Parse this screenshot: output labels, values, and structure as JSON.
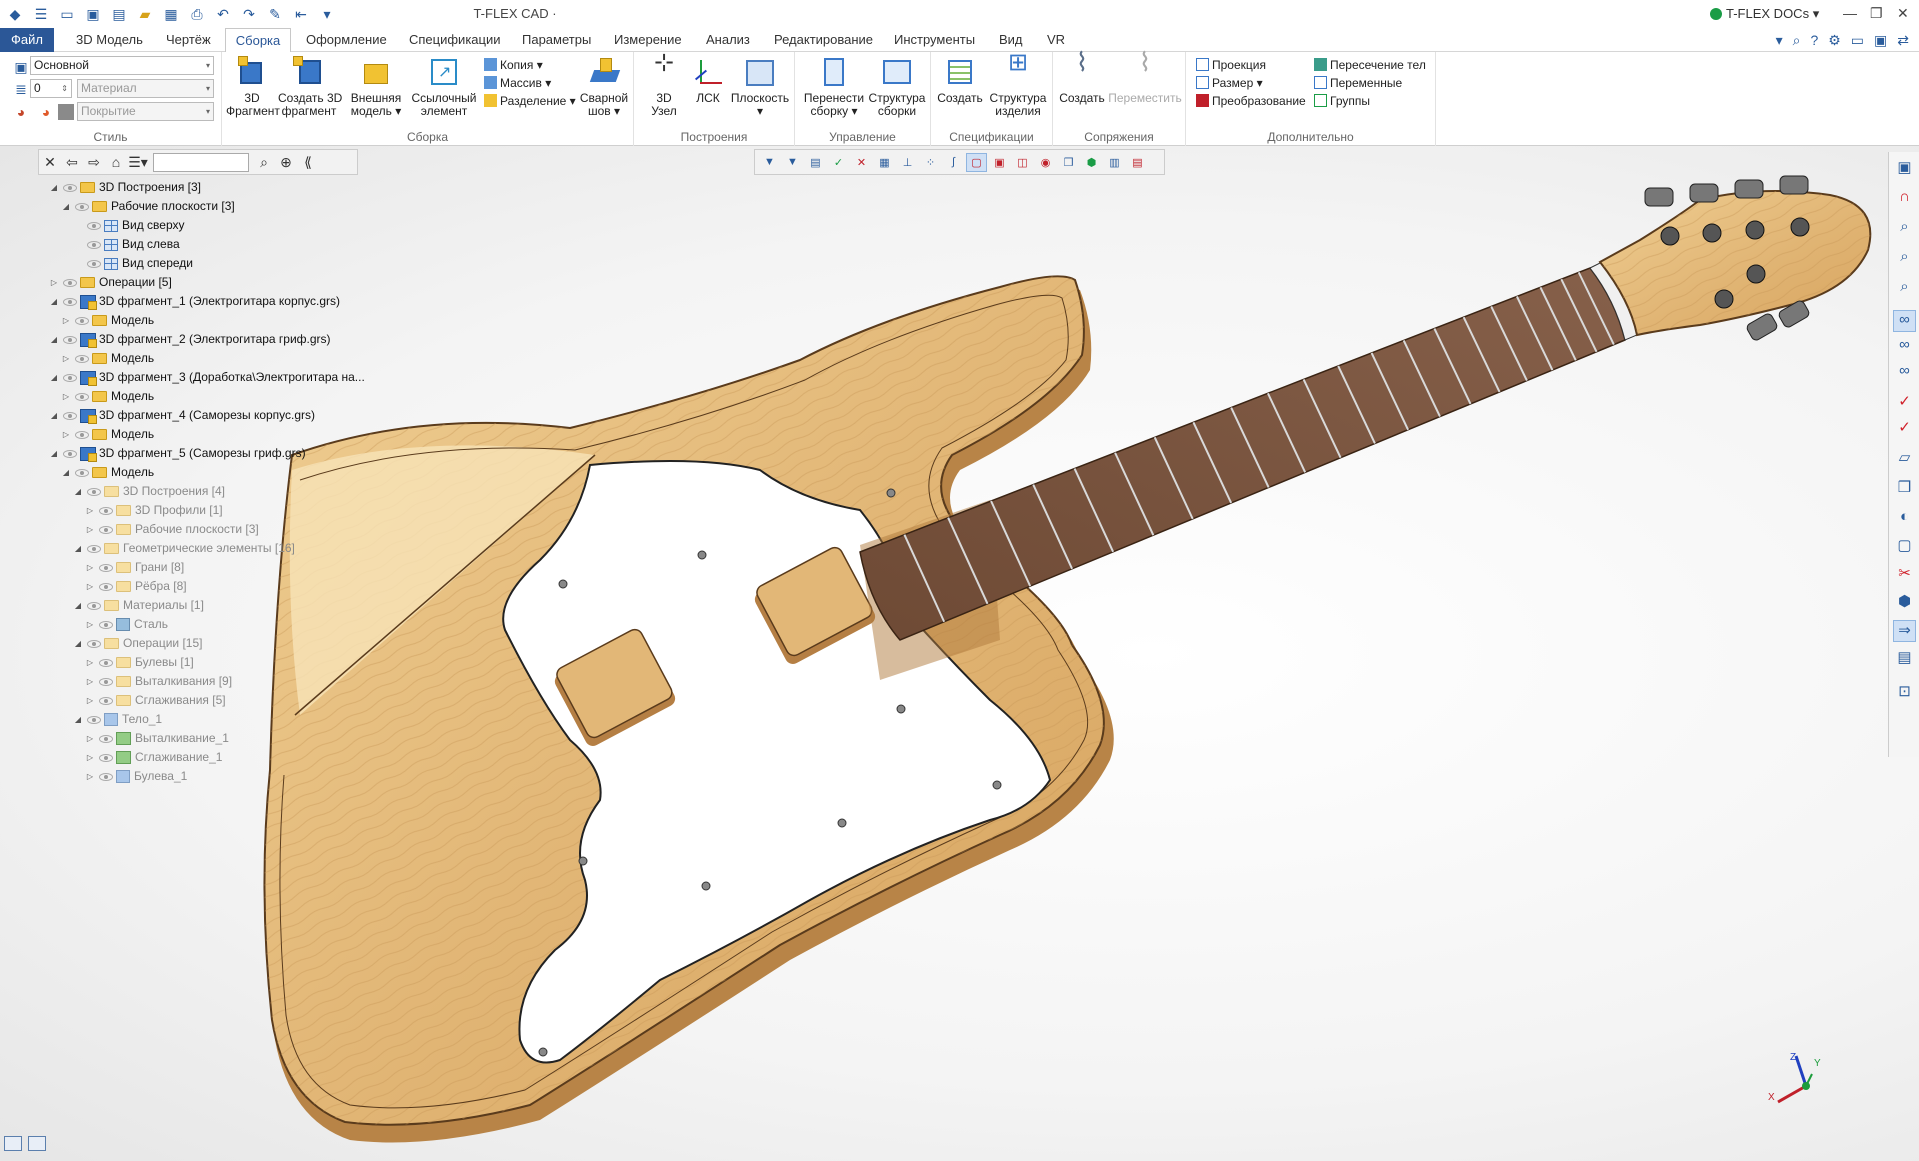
{
  "app": {
    "title": "T-FLEX CAD ·",
    "docs_label": "T-FLEX DOCs"
  },
  "tabs": [
    "Файл",
    "3D Модель",
    "Чертёж",
    "Сборка",
    "Оформление",
    "Спецификации",
    "Параметры",
    "Измерение",
    "Анализ",
    "Редактирование",
    "Инструменты",
    "Вид",
    "VR"
  ],
  "active_tab": "Сборка",
  "ribbon": {
    "style": {
      "label": "Стиль",
      "layer": "Основной",
      "level": "0",
      "material": "Материал",
      "coating": "Покрытие"
    },
    "assembly": {
      "label": "Сборка",
      "buttons": [
        "3D\nФрагмент",
        "Создать 3D\nфрагмент",
        "Внешняя\nмодель ▾",
        "Ссылочный\nэлемент",
        "Сварной\nшов ▾"
      ],
      "small": [
        "Копия",
        "Массив",
        "Разделение"
      ]
    },
    "constructions": {
      "label": "Построения",
      "buttons": [
        "3D\nУзел",
        "ЛСК",
        "Плоскость\n▾"
      ]
    },
    "management": {
      "label": "Управление",
      "buttons": [
        "Перенести\nсборку ▾",
        "Структура\nсборки"
      ]
    },
    "specs": {
      "label": "Спецификации",
      "buttons": [
        "Создать",
        "Структура\nизделия"
      ]
    },
    "mates": {
      "label": "Сопряжения",
      "buttons": [
        "Создать",
        "Переместить"
      ]
    },
    "extra": {
      "label": "Дополнительно",
      "small": [
        "Проекция",
        "Размер",
        "Преобразование",
        "Пересечение тел",
        "Переменные",
        "Группы"
      ]
    }
  },
  "tree": [
    {
      "t": "3D Построения [3]",
      "lvl": 0,
      "ico": "fold"
    },
    {
      "t": "Рабочие плоскости [3]",
      "lvl": 1,
      "ico": "fold"
    },
    {
      "t": "Вид сверху",
      "lvl": 2,
      "ico": "pl"
    },
    {
      "t": "Вид слева",
      "lvl": 2,
      "ico": "pl"
    },
    {
      "t": "Вид спереди",
      "lvl": 2,
      "ico": "pl"
    },
    {
      "t": "Операции [5]",
      "lvl": 0,
      "ico": "fold"
    },
    {
      "t": "3D фрагмент_1 (Электрогитара корпус.grs)",
      "lvl": 0,
      "ico": "frag"
    },
    {
      "t": "Модель",
      "lvl": 1,
      "ico": "fold"
    },
    {
      "t": "3D фрагмент_2 (Электрогитара гриф.grs)",
      "lvl": 0,
      "ico": "frag"
    },
    {
      "t": "Модель",
      "lvl": 1,
      "ico": "fold"
    },
    {
      "t": "3D фрагмент_3 (Доработка\\Электрогитара на...",
      "lvl": 0,
      "ico": "frag"
    },
    {
      "t": "Модель",
      "lvl": 1,
      "ico": "fold"
    },
    {
      "t": "3D фрагмент_4 (Саморезы корпус.grs)",
      "lvl": 0,
      "ico": "frag"
    },
    {
      "t": "Модель",
      "lvl": 1,
      "ico": "fold"
    },
    {
      "t": "3D фрагмент_5 (Саморезы гриф.grs)",
      "lvl": 0,
      "ico": "frag"
    },
    {
      "t": "Модель",
      "lvl": 1,
      "ico": "fold"
    },
    {
      "t": "3D Построения [4]",
      "lvl": 2,
      "ico": "foldd",
      "dim": true
    },
    {
      "t": "3D Профили [1]",
      "lvl": 3,
      "ico": "foldd",
      "dim": true
    },
    {
      "t": "Рабочие плоскости [3]",
      "lvl": 3,
      "ico": "foldd",
      "dim": true
    },
    {
      "t": "Геометрические элементы [16]",
      "lvl": 2,
      "ico": "foldd",
      "dim": true
    },
    {
      "t": "Грани [8]",
      "lvl": 3,
      "ico": "foldd",
      "dim": true
    },
    {
      "t": "Рёбра [8]",
      "lvl": 3,
      "ico": "foldd",
      "dim": true
    },
    {
      "t": "Материалы [1]",
      "lvl": 2,
      "ico": "foldd",
      "dim": true
    },
    {
      "t": "Сталь",
      "lvl": 3,
      "ico": "mat",
      "dim": true
    },
    {
      "t": "Операции [15]",
      "lvl": 2,
      "ico": "foldd",
      "dim": true
    },
    {
      "t": "Булевы [1]",
      "lvl": 3,
      "ico": "foldd",
      "dim": true
    },
    {
      "t": "Выталкивания [9]",
      "lvl": 3,
      "ico": "foldd",
      "dim": true
    },
    {
      "t": "Сглаживания [5]",
      "lvl": 3,
      "ico": "foldd",
      "dim": true
    },
    {
      "t": "Тело_1",
      "lvl": 2,
      "ico": "cubed",
      "dim": true
    },
    {
      "t": "Выталкивание_1",
      "lvl": 3,
      "ico": "feat",
      "dim": true
    },
    {
      "t": "Сглаживание_1",
      "lvl": 3,
      "ico": "feat",
      "dim": true
    },
    {
      "t": "Булева_1",
      "lvl": 3,
      "ico": "cubed",
      "dim": true
    }
  ],
  "triad": {
    "x": "X",
    "y": "Y",
    "z": "Z"
  }
}
